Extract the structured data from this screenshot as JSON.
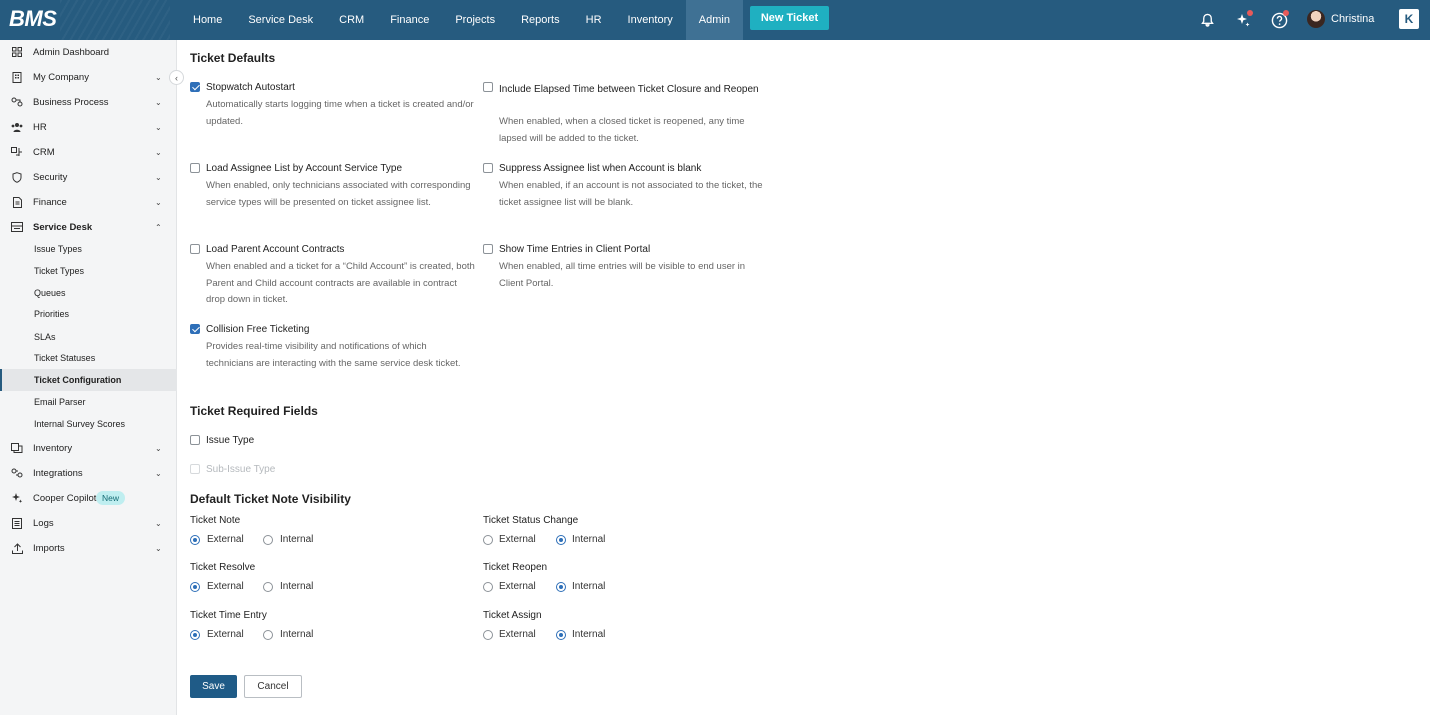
{
  "app": {
    "logo": "BMS"
  },
  "topnav": {
    "items": [
      "Home",
      "Service Desk",
      "CRM",
      "Finance",
      "Projects",
      "Reports",
      "HR",
      "Inventory",
      "Admin"
    ],
    "active": "Admin",
    "new_ticket": "New Ticket",
    "user_name": "Christina",
    "app_tile": "K"
  },
  "sidebar": {
    "items": [
      {
        "label": "Admin Dashboard",
        "icon": "grid-icon"
      },
      {
        "label": "My Company",
        "icon": "building-icon"
      },
      {
        "label": "Business Process",
        "icon": "process-icon"
      },
      {
        "label": "HR",
        "icon": "people-icon"
      },
      {
        "label": "CRM",
        "icon": "crm-icon"
      },
      {
        "label": "Security",
        "icon": "shield-icon"
      },
      {
        "label": "Finance",
        "icon": "document-icon"
      },
      {
        "label": "Service Desk",
        "icon": "service-desk-icon"
      }
    ],
    "service_desk_sub": [
      "Issue Types",
      "Ticket Types",
      "Queues",
      "Priorities",
      "SLAs",
      "Ticket Statuses",
      "Ticket Configuration",
      "Email Parser",
      "Internal Survey Scores"
    ],
    "selected_sub": "Ticket Configuration",
    "items_after": [
      {
        "label": "Inventory",
        "icon": "inventory-icon"
      },
      {
        "label": "Integrations",
        "icon": "integrations-icon"
      },
      {
        "label": "Cooper Copilot",
        "icon": "sparkle-icon",
        "badge": "New"
      },
      {
        "label": "Logs",
        "icon": "logs-icon"
      },
      {
        "label": "Imports",
        "icon": "upload-icon"
      }
    ]
  },
  "ticket_defaults": {
    "title": "Ticket Defaults",
    "options": [
      {
        "label": "Stopwatch Autostart",
        "checked": true,
        "desc": "Automatically starts logging time when a ticket is created and/or updated."
      },
      {
        "label": "Include Elapsed Time between Ticket Closure and Reopen",
        "checked": false,
        "desc": "When enabled, when a closed ticket is reopened, any time lapsed will be added to the ticket."
      },
      {
        "label": "Load Assignee List by Account Service Type",
        "checked": false,
        "desc": "When enabled, only technicians associated with corresponding service types will be presented on ticket assignee list."
      },
      {
        "label": "Suppress Assignee list when Account is blank",
        "checked": false,
        "desc": "When enabled, if an account is not associated to the ticket, the ticket assignee list will be blank."
      },
      {
        "label": "Load Parent Account Contracts",
        "checked": false,
        "desc": "When enabled and a ticket for a “Child Account” is created, both Parent and Child account contracts are available in contract drop down in ticket."
      },
      {
        "label": "Show Time Entries in Client Portal",
        "checked": false,
        "desc": "When enabled, all time entries will be visible to end user in Client Portal."
      },
      {
        "label": "Collision Free Ticketing",
        "checked": true,
        "desc": "Provides real-time visibility and notifications of which technicians are interacting with the same service desk ticket."
      }
    ]
  },
  "required_fields": {
    "title": "Ticket Required Fields",
    "options": [
      {
        "label": "Issue Type",
        "checked": false,
        "disabled": false
      },
      {
        "label": "Sub-Issue Type",
        "checked": false,
        "disabled": true
      }
    ]
  },
  "note_visibility": {
    "title": "Default Ticket Note Visibility",
    "external_label": "External",
    "internal_label": "Internal",
    "fields": [
      {
        "label": "Ticket Note",
        "value": "External"
      },
      {
        "label": "Ticket Status Change",
        "value": "Internal"
      },
      {
        "label": "Ticket Resolve",
        "value": "External"
      },
      {
        "label": "Ticket Reopen",
        "value": "Internal"
      },
      {
        "label": "Ticket Time Entry",
        "value": "External"
      },
      {
        "label": "Ticket Assign",
        "value": "Internal"
      }
    ]
  },
  "actions": {
    "save": "Save",
    "cancel": "Cancel"
  },
  "colors": {
    "topbar": "#265b7f",
    "accent": "#1fb0c1",
    "primary": "#1f5b87",
    "check": "#2e6fb8"
  }
}
